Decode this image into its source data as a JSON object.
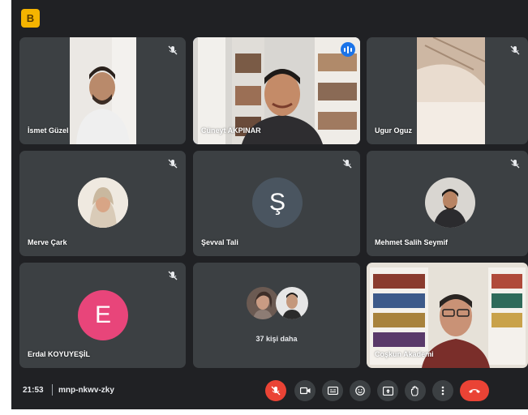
{
  "brand_label": "B",
  "participants": [
    {
      "name": "İsmet Güzel"
    },
    {
      "name": "Cüneyt AKPINAR"
    },
    {
      "name": "Ugur Oguz"
    },
    {
      "name": "Merve Çark"
    },
    {
      "name": "Şevval Tali",
      "initial": "Ş"
    },
    {
      "name": "Mehmet Salih Seymif"
    },
    {
      "name": "Erdal KOYUYEŞİL",
      "initial": "E"
    },
    {
      "more_label": "37 kişi daha"
    },
    {
      "name": "Coşkun Akademi"
    }
  ],
  "meeting": {
    "time": "21:53",
    "code": "mnp-nkwv-zky"
  },
  "colors": {
    "background": "#202124",
    "tile": "#3c4043",
    "accent_red": "#ea4335",
    "speaking": "#8ab4f8",
    "avatar_s": "#4a5560",
    "avatar_e": "#e8457a"
  },
  "controls": [
    {
      "icon": "mic-off-icon"
    },
    {
      "icon": "camera-icon"
    },
    {
      "icon": "captions-icon"
    },
    {
      "icon": "emoji-icon"
    },
    {
      "icon": "present-icon"
    },
    {
      "icon": "raise-hand-icon"
    },
    {
      "icon": "more-options-icon"
    },
    {
      "icon": "end-call-icon"
    }
  ]
}
